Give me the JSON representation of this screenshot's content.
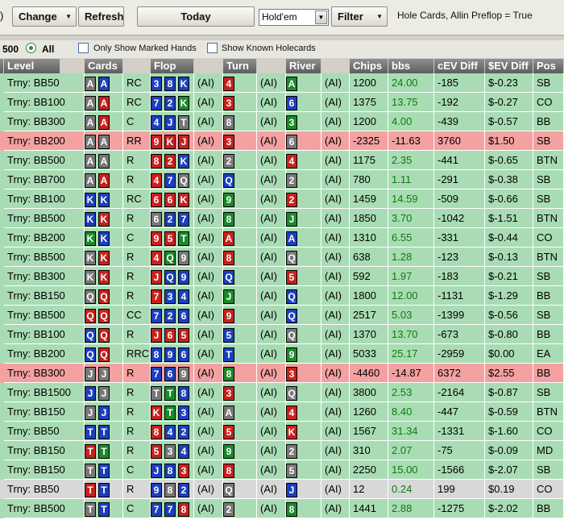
{
  "toolbar": {
    "paren": ")",
    "change_label": "Change",
    "refresh_label": "Refresh",
    "today_label": "Today",
    "game_select_value": "Hold'em",
    "filter_label": "Filter",
    "status_text": "Hole Cards, Allin Preflop = True"
  },
  "options": {
    "count_label": "500",
    "all_label": "All",
    "marked_label": "Only Show Marked Hands",
    "holecards_label": "Show Known Holecards"
  },
  "grid": {
    "columns": [
      "Level",
      "Cards",
      "Flop",
      "Turn",
      "River",
      "Chips",
      "bbs",
      "cEV Diff",
      "$EV Diff",
      "Pos"
    ],
    "colors": {
      "green": "#a9dcb4",
      "red": "#f4a1a1",
      "gray": "#d8d8d8",
      "positive_text": "#0a7d0a"
    },
    "rows": [
      {
        "level": "Trny: BB50",
        "cards": [
          "As",
          "Ad"
        ],
        "action": "RC",
        "flop": [
          "3d",
          "8d",
          "Kd"
        ],
        "flop_ai": "(AI)",
        "turn": "4h",
        "turn_ai": "(AI)",
        "river": "Ac",
        "river_ai": "(AI)",
        "chips": "1200",
        "bbs": "24.00",
        "cev": "-185",
        "ev": "$-0.23",
        "pos": "SB",
        "color": "green"
      },
      {
        "level": "Trny: BB100",
        "cards": [
          "As",
          "Ah"
        ],
        "action": "RC",
        "flop": [
          "7d",
          "2d",
          "Kc"
        ],
        "flop_ai": "(AI)",
        "turn": "3h",
        "turn_ai": "(AI)",
        "river": "6d",
        "river_ai": "(AI)",
        "chips": "1375",
        "bbs": "13.75",
        "cev": "-192",
        "ev": "$-0.27",
        "pos": "CO",
        "color": "green"
      },
      {
        "level": "Trny: BB300",
        "cards": [
          "As",
          "Ah"
        ],
        "action": "C",
        "flop": [
          "4d",
          "Jd",
          "Ts"
        ],
        "flop_ai": "(AI)",
        "turn": "8s",
        "turn_ai": "(AI)",
        "river": "3c",
        "river_ai": "(AI)",
        "chips": "1200",
        "bbs": "4.00",
        "cev": "-439",
        "ev": "$-0.57",
        "pos": "BB",
        "color": "green"
      },
      {
        "level": "Trny: BB200",
        "cards": [
          "As",
          "As"
        ],
        "action": "RR",
        "flop": [
          "9h",
          "Kh",
          "Jh"
        ],
        "flop_ai": "(AI)",
        "turn": "3h",
        "turn_ai": "(AI)",
        "river": "6s",
        "river_ai": "(AI)",
        "chips": "-2325",
        "bbs": "-11.63",
        "cev": "3760",
        "ev": "$1.50",
        "pos": "SB",
        "color": "red"
      },
      {
        "level": "Trny: BB500",
        "cards": [
          "As",
          "As"
        ],
        "action": "R",
        "flop": [
          "8h",
          "2h",
          "Kd"
        ],
        "flop_ai": "(AI)",
        "turn": "2s",
        "turn_ai": "(AI)",
        "river": "4h",
        "river_ai": "(AI)",
        "chips": "1175",
        "bbs": "2.35",
        "cev": "-441",
        "ev": "$-0.65",
        "pos": "BTN",
        "color": "green"
      },
      {
        "level": "Trny: BB700",
        "cards": [
          "As",
          "Ah"
        ],
        "action": "R",
        "flop": [
          "4h",
          "7d",
          "Qs"
        ],
        "flop_ai": "(AI)",
        "turn": "Qd",
        "turn_ai": "(AI)",
        "river": "2s",
        "river_ai": "(AI)",
        "chips": "780",
        "bbs": "1.11",
        "cev": "-291",
        "ev": "$-0.38",
        "pos": "SB",
        "color": "green"
      },
      {
        "level": "Trny: BB100",
        "cards": [
          "Kd",
          "Kd"
        ],
        "action": "RC",
        "flop": [
          "6h",
          "6h",
          "Kh"
        ],
        "flop_ai": "(AI)",
        "turn": "9c",
        "turn_ai": "(AI)",
        "river": "2h",
        "river_ai": "(AI)",
        "chips": "1459",
        "bbs": "14.59",
        "cev": "-509",
        "ev": "$-0.66",
        "pos": "SB",
        "color": "green"
      },
      {
        "level": "Trny: BB500",
        "cards": [
          "Kd",
          "Kh"
        ],
        "action": "R",
        "flop": [
          "6s",
          "2d",
          "7d"
        ],
        "flop_ai": "(AI)",
        "turn": "8c",
        "turn_ai": "(AI)",
        "river": "Jc",
        "river_ai": "(AI)",
        "chips": "1850",
        "bbs": "3.70",
        "cev": "-1042",
        "ev": "$-1.51",
        "pos": "BTN",
        "color": "green"
      },
      {
        "level": "Trny: BB200",
        "cards": [
          "Kc",
          "Kd"
        ],
        "action": "C",
        "flop": [
          "9h",
          "5h",
          "Tc"
        ],
        "flop_ai": "(AI)",
        "turn": "Ah",
        "turn_ai": "(AI)",
        "river": "Ad",
        "river_ai": "(AI)",
        "chips": "1310",
        "bbs": "6.55",
        "cev": "-331",
        "ev": "$-0.44",
        "pos": "CO",
        "color": "green"
      },
      {
        "level": "Trny: BB500",
        "cards": [
          "Ks",
          "Kh"
        ],
        "action": "R",
        "flop": [
          "4h",
          "Qc",
          "9s"
        ],
        "flop_ai": "(AI)",
        "turn": "8h",
        "turn_ai": "(AI)",
        "river": "Qs",
        "river_ai": "(AI)",
        "chips": "638",
        "bbs": "1.28",
        "cev": "-123",
        "ev": "$-0.13",
        "pos": "BTN",
        "color": "green"
      },
      {
        "level": "Trny: BB300",
        "cards": [
          "Ks",
          "Kh"
        ],
        "action": "R",
        "flop": [
          "Jh",
          "Qd",
          "9d"
        ],
        "flop_ai": "(AI)",
        "turn": "Qd",
        "turn_ai": "(AI)",
        "river": "5h",
        "river_ai": "(AI)",
        "chips": "592",
        "bbs": "1.97",
        "cev": "-183",
        "ev": "$-0.21",
        "pos": "SB",
        "color": "green"
      },
      {
        "level": "Trny: BB150",
        "cards": [
          "Qs",
          "Qh"
        ],
        "action": "R",
        "flop": [
          "7h",
          "3d",
          "4d"
        ],
        "flop_ai": "(AI)",
        "turn": "Jc",
        "turn_ai": "(AI)",
        "river": "Qd",
        "river_ai": "(AI)",
        "chips": "1800",
        "bbs": "12.00",
        "cev": "-1131",
        "ev": "$-1.29",
        "pos": "BB",
        "color": "green"
      },
      {
        "level": "Trny: BB500",
        "cards": [
          "Qh",
          "Qh"
        ],
        "action": "CC",
        "flop": [
          "7d",
          "2d",
          "6d"
        ],
        "flop_ai": "(AI)",
        "turn": "9h",
        "turn_ai": "(AI)",
        "river": "Qd",
        "river_ai": "(AI)",
        "chips": "2517",
        "bbs": "5.03",
        "cev": "-1399",
        "ev": "$-0.56",
        "pos": "SB",
        "color": "green"
      },
      {
        "level": "Trny: BB100",
        "cards": [
          "Qd",
          "Qh"
        ],
        "action": "R",
        "flop": [
          "Jh",
          "6h",
          "5h"
        ],
        "flop_ai": "(AI)",
        "turn": "5d",
        "turn_ai": "(AI)",
        "river": "Qs",
        "river_ai": "(AI)",
        "chips": "1370",
        "bbs": "13.70",
        "cev": "-673",
        "ev": "$-0.80",
        "pos": "BB",
        "color": "green"
      },
      {
        "level": "Trny: BB200",
        "cards": [
          "Qd",
          "Qh"
        ],
        "action": "RRC",
        "flop": [
          "8d",
          "9d",
          "6d"
        ],
        "flop_ai": "(AI)",
        "turn": "Td",
        "turn_ai": "(AI)",
        "river": "9c",
        "river_ai": "(AI)",
        "chips": "5033",
        "bbs": "25.17",
        "cev": "-2959",
        "ev": "$0.00",
        "pos": "EA",
        "color": "green"
      },
      {
        "level": "Trny: BB300",
        "cards": [
          "Js",
          "Js"
        ],
        "action": "R",
        "flop": [
          "7d",
          "6d",
          "9s"
        ],
        "flop_ai": "(AI)",
        "turn": "8c",
        "turn_ai": "(AI)",
        "river": "3h",
        "river_ai": "(AI)",
        "chips": "-4460",
        "bbs": "-14.87",
        "cev": "6372",
        "ev": "$2.55",
        "pos": "BB",
        "color": "red"
      },
      {
        "level": "Trny: BB1500",
        "cards": [
          "Jd",
          "Js"
        ],
        "action": "R",
        "flop": [
          "Ts",
          "Tc",
          "8d"
        ],
        "flop_ai": "(AI)",
        "turn": "3h",
        "turn_ai": "(AI)",
        "river": "Qs",
        "river_ai": "(AI)",
        "chips": "3800",
        "bbs": "2.53",
        "cev": "-2164",
        "ev": "$-0.87",
        "pos": "SB",
        "color": "green"
      },
      {
        "level": "Trny: BB150",
        "cards": [
          "Js",
          "Jd"
        ],
        "action": "R",
        "flop": [
          "Kh",
          "Tc",
          "3d"
        ],
        "flop_ai": "(AI)",
        "turn": "As",
        "turn_ai": "(AI)",
        "river": "4h",
        "river_ai": "(AI)",
        "chips": "1260",
        "bbs": "8.40",
        "cev": "-447",
        "ev": "$-0.59",
        "pos": "BTN",
        "color": "green"
      },
      {
        "level": "Trny: BB50",
        "cards": [
          "Td",
          "Td"
        ],
        "action": "R",
        "flop": [
          "8h",
          "4d",
          "2d"
        ],
        "flop_ai": "(AI)",
        "turn": "5h",
        "turn_ai": "(AI)",
        "river": "Kh",
        "river_ai": "(AI)",
        "chips": "1567",
        "bbs": "31.34",
        "cev": "-1331",
        "ev": "$-1.60",
        "pos": "CO",
        "color": "green"
      },
      {
        "level": "Trny: BB150",
        "cards": [
          "Th",
          "Tc"
        ],
        "action": "R",
        "flop": [
          "5h",
          "3s",
          "4d"
        ],
        "flop_ai": "(AI)",
        "turn": "9c",
        "turn_ai": "(AI)",
        "river": "2s",
        "river_ai": "(AI)",
        "chips": "310",
        "bbs": "2.07",
        "cev": "-75",
        "ev": "$-0.09",
        "pos": "MD",
        "color": "green"
      },
      {
        "level": "Trny: BB150",
        "cards": [
          "Ts",
          "Td"
        ],
        "action": "C",
        "flop": [
          "Jd",
          "8d",
          "3h"
        ],
        "flop_ai": "(AI)",
        "turn": "8h",
        "turn_ai": "(AI)",
        "river": "5s",
        "river_ai": "(AI)",
        "chips": "2250",
        "bbs": "15.00",
        "cev": "-1566",
        "ev": "$-2.07",
        "pos": "SB",
        "color": "green"
      },
      {
        "level": "Trny: BB50",
        "cards": [
          "Th",
          "Td"
        ],
        "action": "R",
        "flop": [
          "9d",
          "8s",
          "2d"
        ],
        "flop_ai": "(AI)",
        "turn": "Qs",
        "turn_ai": "(AI)",
        "river": "Jd",
        "river_ai": "(AI)",
        "chips": "12",
        "bbs": "0.24",
        "cev": "199",
        "ev": "$0.19",
        "pos": "CO",
        "color": "gray"
      },
      {
        "level": "Trny: BB500",
        "cards": [
          "Ts",
          "Td"
        ],
        "action": "C",
        "flop": [
          "7d",
          "7d",
          "8h"
        ],
        "flop_ai": "(AI)",
        "turn": "2s",
        "turn_ai": "(AI)",
        "river": "8c",
        "river_ai": "(AI)",
        "chips": "1441",
        "bbs": "2.88",
        "cev": "-1275",
        "ev": "$-2.02",
        "pos": "BB",
        "color": "green"
      }
    ]
  }
}
